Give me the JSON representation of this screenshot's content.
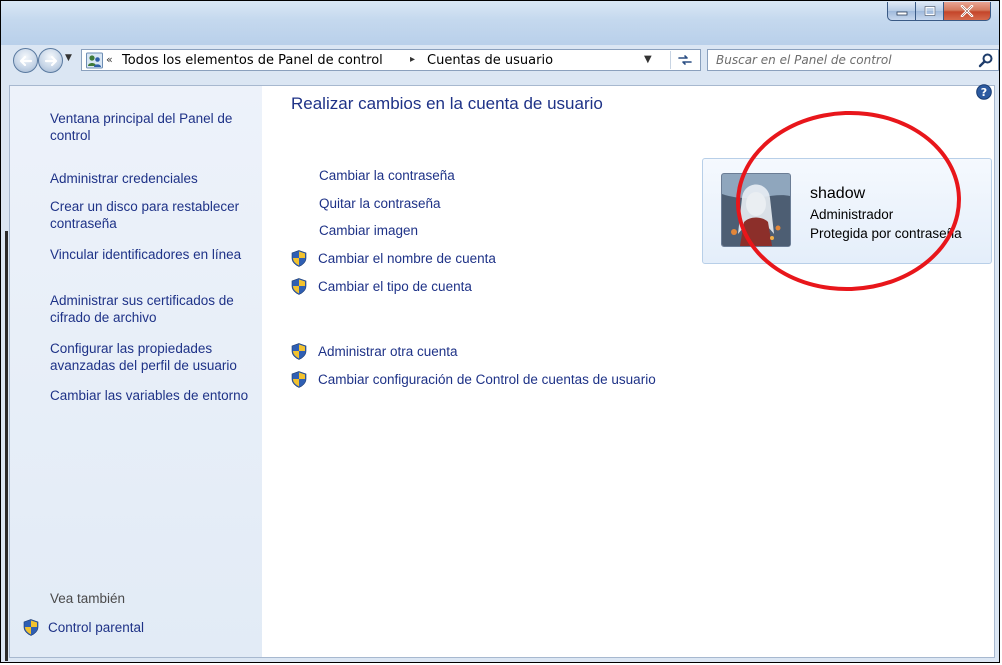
{
  "window": {
    "controls": {
      "minimize": "minimize",
      "maximize": "maximize",
      "close": "close"
    }
  },
  "address_bar": {
    "breadcrumb_overflow": "«",
    "breadcrumb": [
      "Todos los elementos de Panel de control",
      "Cuentas de usuario"
    ],
    "separator": "▸"
  },
  "search": {
    "placeholder": "Buscar en el Panel de control"
  },
  "sidebar": {
    "links": [
      "Ventana principal del Panel de control",
      "Administrar credenciales",
      "Crear un disco para restablecer contraseña",
      "Vincular identificadores en línea",
      "Administrar sus certificados de cifrado de archivo",
      "Configurar las propiedades avanzadas del perfil de usuario",
      "Cambiar las variables de entorno"
    ],
    "see_also_label": "Vea también",
    "parental_control": "Control parental"
  },
  "main": {
    "title": "Realizar cambios en la cuenta de usuario",
    "tasks": [
      {
        "label": "Cambiar la contraseña",
        "shield": false
      },
      {
        "label": "Quitar la contraseña",
        "shield": false
      },
      {
        "label": "Cambiar imagen",
        "shield": false
      },
      {
        "label": "Cambiar el nombre de cuenta",
        "shield": true
      },
      {
        "label": "Cambiar el tipo de cuenta",
        "shield": true
      }
    ],
    "other_tasks": [
      {
        "label": "Administrar otra cuenta",
        "shield": true
      },
      {
        "label": "Cambiar configuración de Control de cuentas de usuario",
        "shield": true
      }
    ]
  },
  "account": {
    "name": "shadow",
    "type": "Administrador",
    "status": "Protegida por contraseña"
  },
  "colors": {
    "link": "#1e3287",
    "highlight_circle": "#e8161b",
    "sidebar_bg": "#e8eff8"
  }
}
